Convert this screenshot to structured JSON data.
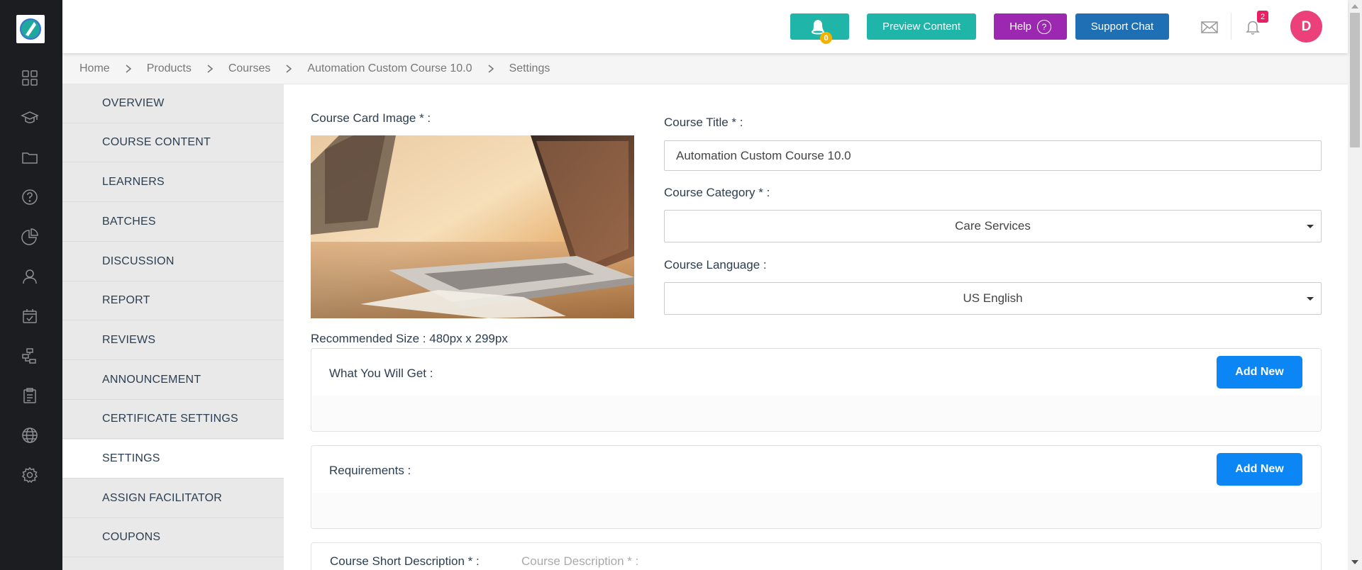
{
  "topbar": {
    "bell_count": "0",
    "preview_label": "Preview Content",
    "help_label": "Help",
    "help_icon_text": "?",
    "support_label": "Support Chat",
    "notification_count": "2",
    "avatar_initial": "D"
  },
  "breadcrumb": [
    "Home",
    "Products",
    "Courses",
    "Automation Custom Course 10.0",
    "Settings"
  ],
  "menu": {
    "items": [
      "OVERVIEW",
      "COURSE CONTENT",
      "LEARNERS",
      "BATCHES",
      "DISCUSSION",
      "REPORT",
      "REVIEWS",
      "ANNOUNCEMENT",
      "CERTIFICATE SETTINGS",
      "SETTINGS",
      "ASSIGN FACILITATOR",
      "COUPONS"
    ],
    "active": "SETTINGS"
  },
  "form": {
    "card_image_label": "Course Card Image * :",
    "recommended_size": "Recommended Size : 480px x 299px",
    "title_label": "Course Title * :",
    "title_value": "Automation Custom Course 10.0",
    "category_label": "Course Category * :",
    "category_value": "Care Services",
    "language_label": "Course Language :",
    "language_value": "US English",
    "what_you_get_label": "What You Will Get :",
    "requirements_label": "Requirements :",
    "add_new_label": "Add New",
    "short_desc_label": "Course Short Description * :",
    "desc_label": "Course Description * :"
  },
  "colors": {
    "rail_bg": "#1c1d21",
    "teal": "#1fb5a8",
    "purple": "#9c27b0",
    "blue": "#1f6fb5",
    "add_new": "#0d86f5",
    "avatar": "#ec407a"
  },
  "icons": {
    "rail": [
      "dashboard-icon",
      "graduation-cap-icon",
      "folder-icon",
      "help-circle-icon",
      "pie-chart-icon",
      "user-icon",
      "calendar-check-icon",
      "hierarchy-icon",
      "clipboard-icon",
      "globe-icon",
      "settings-gear-icon"
    ]
  }
}
